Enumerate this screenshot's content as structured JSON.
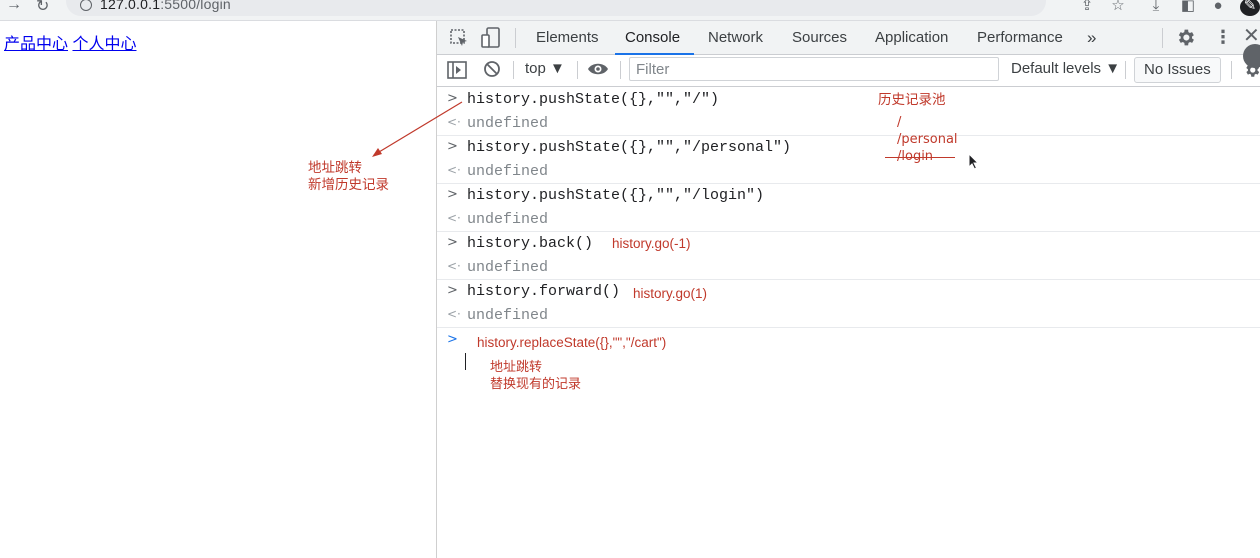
{
  "browser": {
    "url_host": "127.0.0.1",
    "url_rest": ":5500/login"
  },
  "page": {
    "links": [
      "产品中心",
      "个人中心"
    ]
  },
  "devtools": {
    "tabs": [
      "Elements",
      "Console",
      "Network",
      "Sources",
      "Application",
      "Performance"
    ],
    "active_tab": "Console",
    "more_tabs": "»",
    "context": "top ▼",
    "filter_placeholder": "Filter",
    "levels": "Default levels ▼",
    "issues": "No Issues"
  },
  "console": {
    "entries": [
      {
        "input": "history.pushState({},\"\",\"/\")",
        "result": "undefined"
      },
      {
        "input": "history.pushState({},\"\",\"/personal\")",
        "result": "undefined"
      },
      {
        "input": "history.pushState({},\"\",\"/login\")",
        "result": "undefined"
      },
      {
        "input": "history.back()",
        "result": "undefined",
        "note": "history.go(-1)"
      },
      {
        "input": "history.forward()",
        "result": "undefined",
        "note": "history.go(1)"
      }
    ],
    "prompt_text": "history.replaceState({},\"\",\"/cart\")"
  },
  "annotations": {
    "left_note_line1": "地址跳转",
    "left_note_line2": "新增历史记录",
    "pool_title": "历史记录池",
    "pool_items": [
      "/",
      "/personal",
      "/login"
    ],
    "replace_note_line1": "地址跳转",
    "replace_note_line2": "替换现有的记录"
  },
  "colors": {
    "annotation": "#c0392b",
    "link": "#0000ee",
    "active_tab_underline": "#1a73e8"
  }
}
